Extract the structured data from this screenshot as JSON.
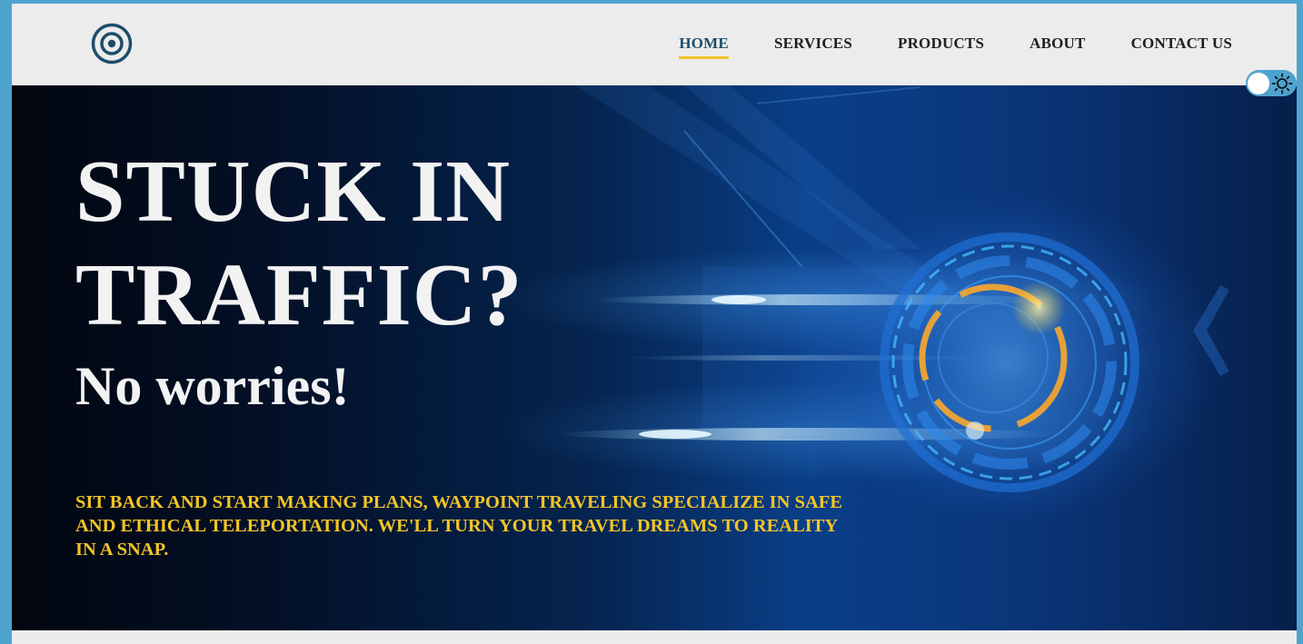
{
  "nav": {
    "items": [
      {
        "label": "HOME",
        "active": true
      },
      {
        "label": "SERVICES",
        "active": false
      },
      {
        "label": "PRODUCTS",
        "active": false
      },
      {
        "label": "ABOUT",
        "active": false
      },
      {
        "label": "CONTACT US",
        "active": false
      }
    ]
  },
  "hero": {
    "headline": "STUCK IN TRAFFIC?",
    "subhead": "No worries!",
    "tagline": "Sit back and start making plans, Waypoint Traveling specialize in safe and ethical teleportation. We'll turn your travel dreams to reality in a snap."
  },
  "icons": {
    "logo": "target-logo-icon",
    "theme": "sun-icon"
  },
  "colors": {
    "page_border": "#4fa3cf",
    "header_bg": "#ececec",
    "accent_yellow": "#f2c428",
    "active_nav": "#1c4d6b",
    "hero_text": "#f2f2f2"
  },
  "theme_toggle": {
    "dark_mode": false
  }
}
